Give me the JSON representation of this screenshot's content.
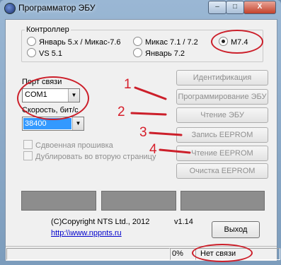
{
  "window": {
    "title": "Программатор ЭБУ",
    "min": "–",
    "max": "□",
    "close": "X"
  },
  "controller": {
    "legend": "Контроллер",
    "options": [
      "Январь 5.x / Микас-7.6",
      "VS 5.1",
      "Микас 7.1 / 7.2",
      "Январь 7.2",
      "M7.4"
    ],
    "selected": "M7.4"
  },
  "port": {
    "label": "Порт связи",
    "value": "COM1"
  },
  "speed": {
    "label": "Скорость, бит/с",
    "value": "38400"
  },
  "checkboxes": [
    "Сдвоенная прошивка",
    "Дублировать во вторую страницу"
  ],
  "buttons": {
    "identify": "Идентификация",
    "program": "Программирование ЭБУ",
    "read_ecu": "Чтение ЭБУ",
    "write_eeprom": "Запись EEPROM",
    "read_eeprom": "Чтение EEPROM",
    "clear_eeprom": "Очистка EEPROM",
    "exit": "Выход"
  },
  "copyright": "(C)Copyright NTS Ltd., 2012",
  "version": "v1.14",
  "link": "http:\\\\www.nppnts.ru",
  "status": {
    "percent": "0%",
    "connection": "Нет связи"
  },
  "annotations": [
    "1",
    "2",
    "3",
    "4"
  ],
  "colors": {
    "annotation": "#cc1f2a",
    "selection": "#3399ff"
  }
}
